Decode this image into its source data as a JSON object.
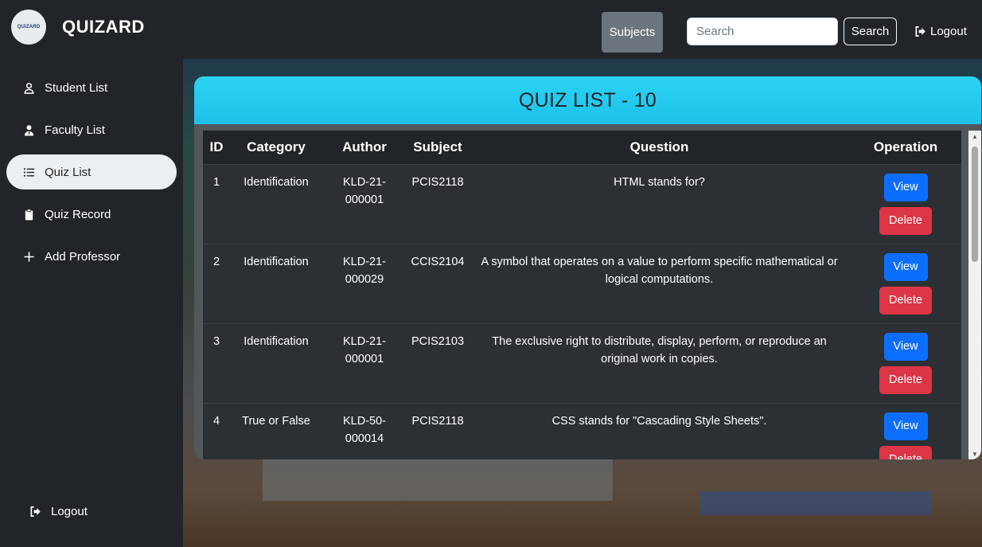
{
  "brand": {
    "name": "QUIZARD",
    "logo_text": "QUIZARD"
  },
  "sidebar": {
    "items": [
      {
        "label": "Student List",
        "icon": "user-icon",
        "active": false
      },
      {
        "label": "Faculty List",
        "icon": "user-tie-icon",
        "active": false
      },
      {
        "label": "Quiz List",
        "icon": "list-icon",
        "active": true
      },
      {
        "label": "Quiz Record",
        "icon": "clipboard-icon",
        "active": false
      },
      {
        "label": "Add Professor",
        "icon": "plus-icon",
        "active": false
      }
    ],
    "logout_label": "Logout"
  },
  "topbar": {
    "subjects_label": "Subjects",
    "search_placeholder": "Search",
    "search_value": "",
    "search_button_label": "Search",
    "logout_label": "Logout"
  },
  "card": {
    "title": "QUIZ LIST - 10"
  },
  "table": {
    "headers": {
      "id": "ID",
      "category": "Category",
      "author": "Author",
      "subject": "Subject",
      "question": "Question",
      "operation": "Operation"
    },
    "view_label": "View",
    "delete_label": "Delete",
    "rows": [
      {
        "id": "1",
        "category": "Identification",
        "author": "KLD-21-000001",
        "subject": "PCIS2118",
        "question": "HTML stands for?"
      },
      {
        "id": "2",
        "category": "Identification",
        "author": "KLD-21-000029",
        "subject": "CCIS2104",
        "question": "A symbol that operates on a value to perform specific mathematical or logical computations."
      },
      {
        "id": "3",
        "category": "Identification",
        "author": "KLD-21-000001",
        "subject": "PCIS2103",
        "question": "The exclusive right to distribute, display, perform, or reproduce an original work in copies."
      },
      {
        "id": "4",
        "category": "True or False",
        "author": "KLD-50-000014",
        "subject": "PCIS2118",
        "question": "CSS stands for \"Cascading Style Sheets\"."
      }
    ]
  },
  "colors": {
    "sidebar_bg": "#212529",
    "header_cyan": "#1fc1e9",
    "view_blue": "#0d6efd",
    "delete_red": "#dc3545",
    "subjects_gray": "#6c757d"
  }
}
